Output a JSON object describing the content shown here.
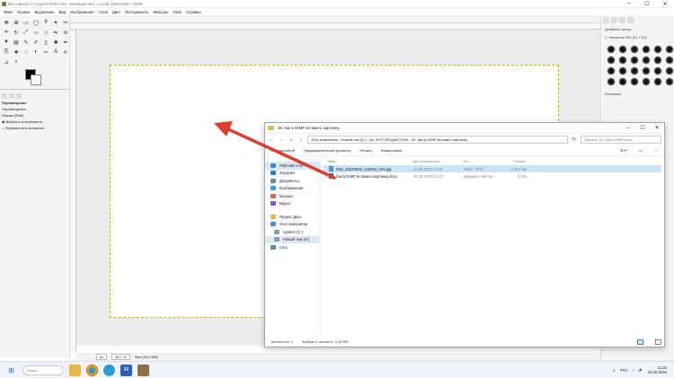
{
  "gimp": {
    "title": "[Без имени]-1.0 (Цвета RGB 8 бит, линейный свет, 1 слой) 1920x1080 – GIMP",
    "menu": [
      "Файл",
      "Правка",
      "Выделение",
      "Вид",
      "Изображение",
      "Слой",
      "Цвет",
      "Инструменты",
      "Фильтры",
      "Окно",
      "Справка"
    ],
    "tool_options": {
      "title": "Перемещение",
      "move_label": "Перемещение:",
      "switch_label": "Режим (Shift)",
      "option1": "Выбрать и перемести",
      "option2": "Переместить активный"
    },
    "status": {
      "unit": "px",
      "zoom": "66,7 %",
      "info": "Фон (54,0 МБ)"
    },
    "dock": {
      "brushes_filter": "Добавить метку",
      "brush_name": "2. Hardness 050 (51 × 51)",
      "spacing_label": "Интервал"
    }
  },
  "explorer": {
    "title": "05. Как в GIMP вставить картинку",
    "address": [
      "Этот компьютер",
      "Новый том (D:)",
      "3А. ФОТОРЕДАКТОРЫ",
      "05. Как в GIMP вставить картинку"
    ],
    "search_placeholder": "Поиск в: 05. Как в GIMP вста...",
    "toolbar": {
      "organize": "Упорядочить ▾",
      "preview": "Предварительный просмотр",
      "print": "Печать",
      "new_folder": "Новая папка"
    },
    "nav": {
      "items": [
        {
          "label": "Рабочий стол",
          "color": "#3b8fd8"
        },
        {
          "label": "Загрузки",
          "color": "#2c7fd0"
        },
        {
          "label": "Документы",
          "color": "#6a86a8"
        },
        {
          "label": "Изображения",
          "color": "#3aa0d8"
        },
        {
          "label": "Музыка",
          "color": "#d96060"
        },
        {
          "label": "Видео",
          "color": "#7a5cc8"
        }
      ],
      "items2": [
        {
          "label": "Яндекс Диск",
          "color": "#e8b84a"
        },
        {
          "label": "Этот компьютер",
          "color": "#4a8ad0"
        },
        {
          "label": "System (C:)",
          "color": "#8a9aaa"
        },
        {
          "label": "Новый том (D:)",
          "color": "#8a9aaa"
        },
        {
          "label": "Сеть",
          "color": "#4a8ad0"
        }
      ]
    },
    "columns": {
      "name": "Имя",
      "date": "Дата изменения",
      "type": "Тип",
      "size": "Размер"
    },
    "files": [
      {
        "name": "IMG_20240922_142844_042.jpg",
        "date": "22.09.2024 14:28",
        "type": "Файл \"JPG\"",
        "size": "3 547 КБ",
        "icon_color": "#5b8fd0"
      },
      {
        "name": "Как в GIMP вставить картинку.docx",
        "date": "30.10.2024 21:22",
        "type": "Документ Micros...",
        "size": "14 КБ",
        "icon_color": "#2b5fb4"
      }
    ],
    "status": {
      "count": "Элементов: 2",
      "selected": "Выбран 1 элемент: 3,46 МБ"
    }
  },
  "taskbar": {
    "search": "Поиск",
    "lang": "РУС",
    "time": "21:22",
    "date": "30.10.2024"
  }
}
